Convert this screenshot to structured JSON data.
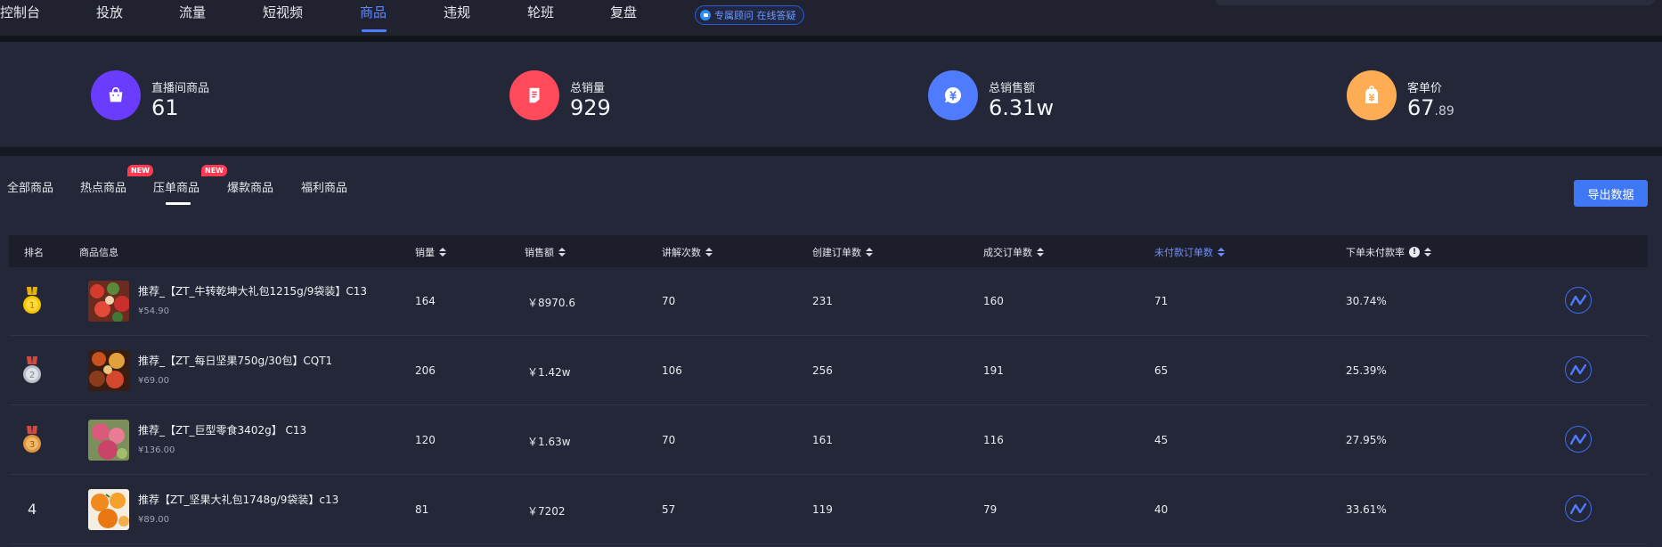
{
  "nav": {
    "items": [
      {
        "label": "控制台",
        "active": false
      },
      {
        "label": "投放",
        "active": false
      },
      {
        "label": "流量",
        "active": false
      },
      {
        "label": "短视频",
        "active": false
      },
      {
        "label": "商品",
        "active": true
      },
      {
        "label": "违规",
        "active": false
      },
      {
        "label": "轮班",
        "active": false
      },
      {
        "label": "复盘",
        "active": false
      }
    ],
    "consult_label": "专属顾问 在线答疑"
  },
  "stats": [
    {
      "label": "直播间商品",
      "value": "61",
      "decimal": "",
      "icon": "shopping-bag-icon",
      "color": "#6a3cff"
    },
    {
      "label": "总销量",
      "value": "929",
      "decimal": "",
      "icon": "document-icon",
      "color": "#ff4a5c"
    },
    {
      "label": "总销售额",
      "value": "6.31w",
      "decimal": "",
      "icon": "yuan-bubble-icon",
      "color": "#4f7cff"
    },
    {
      "label": "客单价",
      "value": "67",
      "decimal": ".89",
      "icon": "price-tag-icon",
      "color": "#ffad55"
    }
  ],
  "tabs": [
    {
      "label": "全部商品",
      "badge": "",
      "active": false
    },
    {
      "label": "热点商品",
      "badge": "NEW",
      "active": false
    },
    {
      "label": "压单商品",
      "badge": "NEW",
      "active": true
    },
    {
      "label": "爆款商品",
      "badge": "",
      "active": false
    },
    {
      "label": "福利商品",
      "badge": "",
      "active": false
    }
  ],
  "export_label": "导出数据",
  "columns": {
    "rank": "排名",
    "info": "商品信息",
    "sales": "销量",
    "revenue": "销售额",
    "explain": "讲解次数",
    "created": "创建订单数",
    "completed": "成交订单数",
    "unpaid": "未付款订单数",
    "unpaid_rate": "下单未付款率"
  },
  "rows": [
    {
      "rank": "1",
      "medal": "gold",
      "name": "推荐_【ZT_牛转乾坤大礼包1215g/9袋装】C13",
      "price": "¥54.90",
      "sales": "164",
      "revenue": "￥8970.6",
      "explain": "70",
      "created": "231",
      "completed": "160",
      "unpaid": "71",
      "unpaid_rate": "30.74%"
    },
    {
      "rank": "2",
      "medal": "silver",
      "name": "推荐_【ZT_每日坚果750g/30包】CQT1",
      "price": "¥69.00",
      "sales": "206",
      "revenue": "￥1.42w",
      "explain": "106",
      "created": "256",
      "completed": "191",
      "unpaid": "65",
      "unpaid_rate": "25.39%"
    },
    {
      "rank": "3",
      "medal": "bronze",
      "name": "推荐_【ZT_巨型零食3402g】 C13",
      "price": "¥136.00",
      "sales": "120",
      "revenue": "￥1.63w",
      "explain": "70",
      "created": "161",
      "completed": "116",
      "unpaid": "45",
      "unpaid_rate": "27.95%"
    },
    {
      "rank": "4",
      "medal": "",
      "name": "推荐【ZT_坚果大礼包1748g/9袋装】c13",
      "price": "¥89.00",
      "sales": "81",
      "revenue": "￥7202",
      "explain": "57",
      "created": "119",
      "completed": "79",
      "unpaid": "40",
      "unpaid_rate": "33.61%"
    }
  ],
  "colors": {
    "accent": "#4f7cff",
    "gold": "#f5c400",
    "silver": "#c4c8d0",
    "bronze": "#e8a04a"
  }
}
